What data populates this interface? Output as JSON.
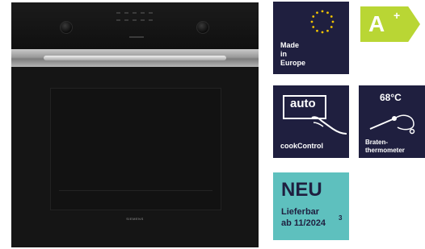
{
  "product": {
    "brand": "SIEMENS"
  },
  "badges": {
    "europe": {
      "line1": "Made",
      "line2": "in",
      "line3": "Europe",
      "star_icon": "eu-stars-icon"
    },
    "energy": {
      "class": "A",
      "suffix": "+",
      "color": "#b9d634"
    },
    "cook_control": {
      "display_text": "auto",
      "label": "cookControl"
    },
    "thermometer": {
      "temperature": "68°C",
      "label_line1": "Braten-",
      "label_line2": "thermometer"
    },
    "new": {
      "title": "NEU",
      "line1": "Lieferbar",
      "line2": "ab 11/2024",
      "footnote": "3",
      "color": "#5ec0be"
    }
  },
  "colors": {
    "badge_navy": "#1f1f3f"
  }
}
